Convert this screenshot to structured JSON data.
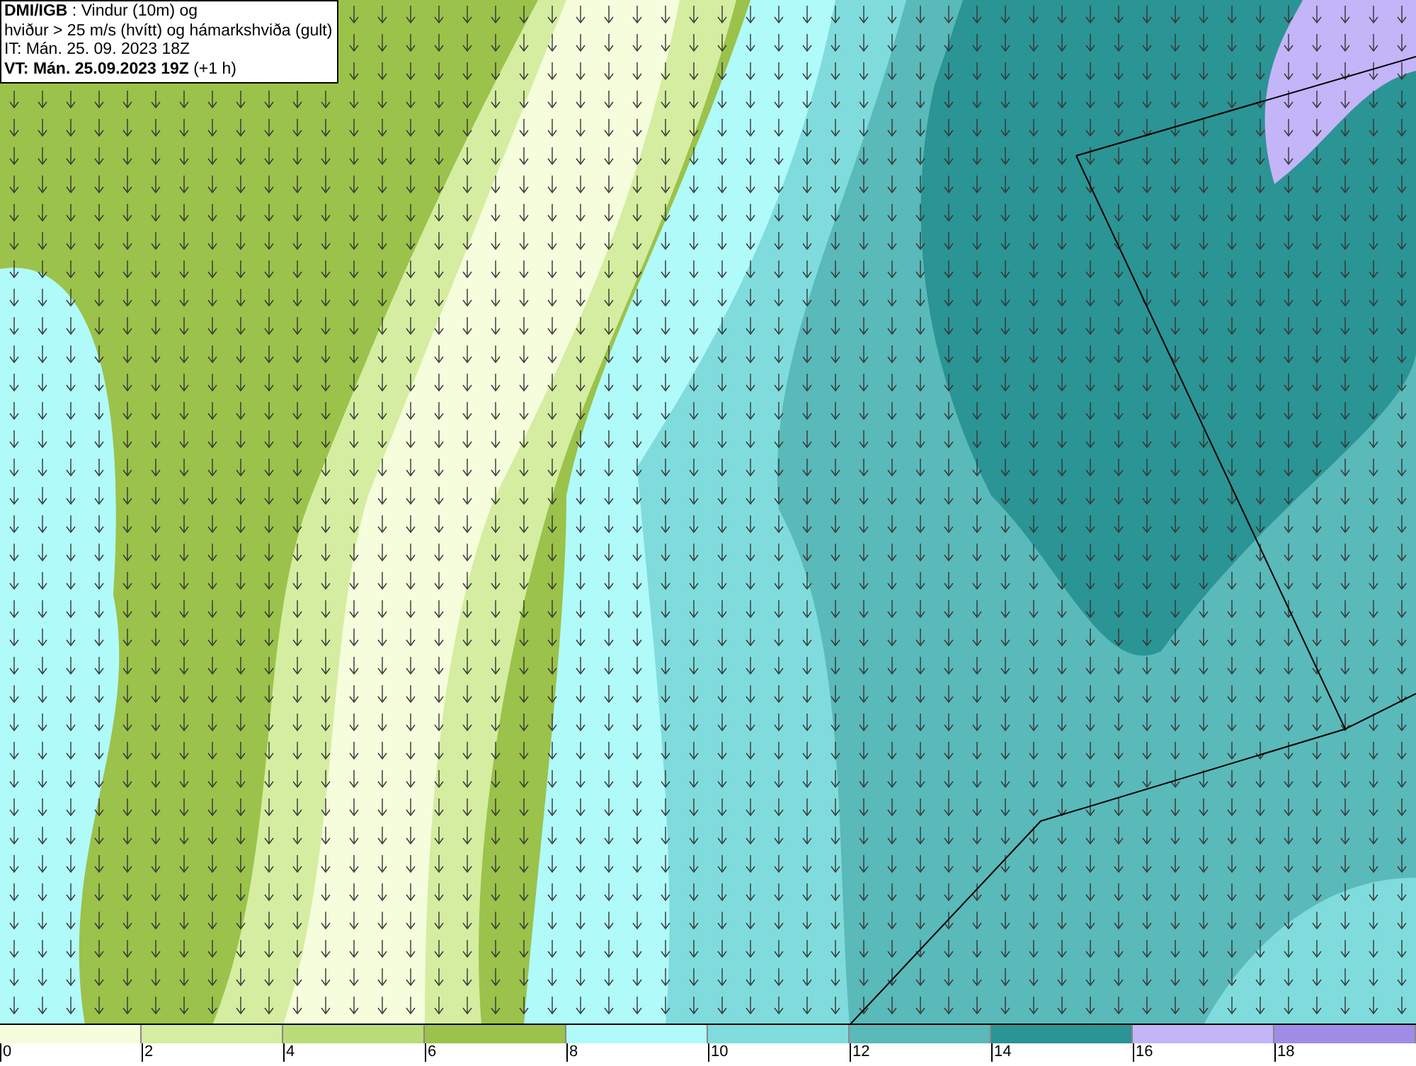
{
  "title_box": {
    "lines": [
      "**DMI/IGB** : Vindur (10m) og",
      "hviður > 25 m/s (hvítt) og hámarkshviða (gult)",
      "IT: Mán. 25. 09. 2023 18Z",
      "**VT: Mán. 25.09.2023 19Z** (+1 h)"
    ]
  },
  "legend": [
    {
      "label": "0",
      "color": "#f5fddc"
    },
    {
      "label": "2",
      "color": "#d5eda0"
    },
    {
      "label": "4",
      "color": "#b9dc78"
    },
    {
      "label": "6",
      "color": "#9bc24a"
    },
    {
      "label": "8",
      "color": "#b0fafa"
    },
    {
      "label": "10",
      "color": "#80dcdc"
    },
    {
      "label": "12",
      "color": "#5ab9b9"
    },
    {
      "label": "14",
      "color": "#2b9494"
    },
    {
      "label": "16",
      "color": "#c4b4f8"
    },
    {
      "label": "18",
      "color": "#a08ce6"
    }
  ]
}
